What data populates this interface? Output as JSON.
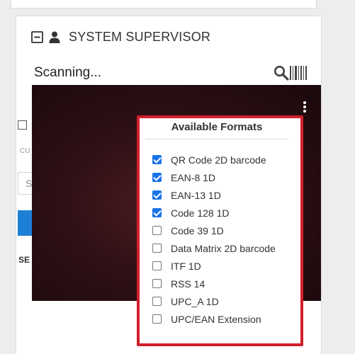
{
  "header": {
    "title": "SYSTEM SUPERVISOR",
    "collapse_icon": "minus-square-icon",
    "user_icon": "user-icon"
  },
  "scanner": {
    "status_text": "Scanning...",
    "search_icon": "search-icon",
    "barcode_icon": "barcode-icon",
    "menu_icon": "kebab-menu-icon"
  },
  "background_fragments": {
    "label": "CU",
    "input_text": "S",
    "section_label": "SE"
  },
  "formats_panel": {
    "title": "Available Formats",
    "items": [
      {
        "label": "QR Code 2D barcode",
        "checked": true
      },
      {
        "label": "EAN-8 1D",
        "checked": true
      },
      {
        "label": "EAN-13 1D",
        "checked": true
      },
      {
        "label": "Code 128 1D",
        "checked": true
      },
      {
        "label": "Code 39 1D",
        "checked": false
      },
      {
        "label": "Data Matrix 2D barcode",
        "checked": false
      },
      {
        "label": "ITF 1D",
        "checked": false
      },
      {
        "label": "RSS 14",
        "checked": false
      },
      {
        "label": "UPC_A 1D",
        "checked": false
      },
      {
        "label": "UPC/EAN Extension",
        "checked": false
      }
    ]
  },
  "colors": {
    "highlight_border": "#d21f2b",
    "checkbox_checked": "#1a73e8",
    "primary_button": "#1e7fd7",
    "camera_background": "#2e1015"
  }
}
